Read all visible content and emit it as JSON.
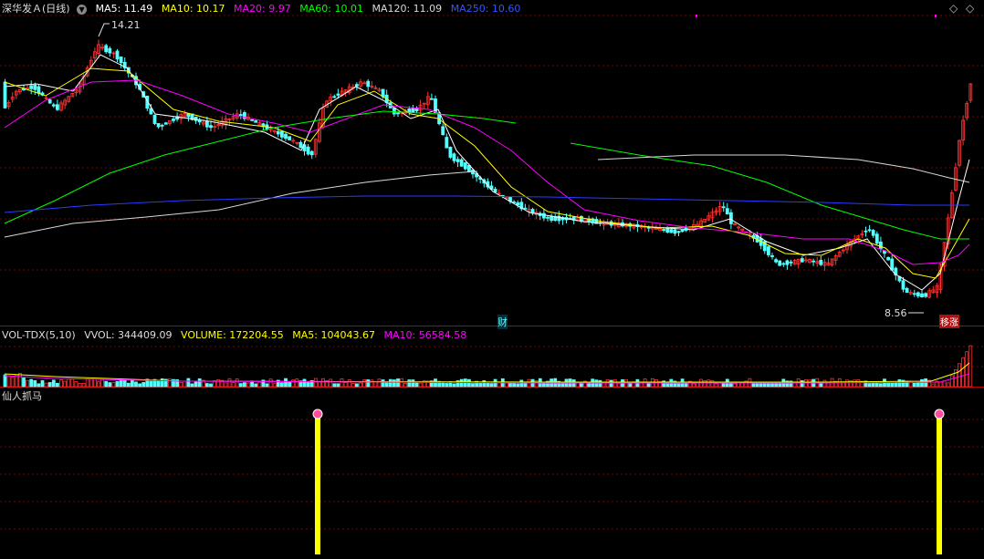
{
  "main": {
    "title": "深华发Ａ(日线)",
    "ma": [
      {
        "label": "MA5: 11.49",
        "color": "#ffffff"
      },
      {
        "label": "MA10: 10.17",
        "color": "#ffff00"
      },
      {
        "label": "MA20: 9.97",
        "color": "#ff00ff"
      },
      {
        "label": "MA60: 10.01",
        "color": "#00ff00"
      },
      {
        "label": "MA120: 11.09",
        "color": "#d8d8d8"
      },
      {
        "label": "MA250: 10.60",
        "color": "#0000ff"
      }
    ],
    "high_label": "14.21",
    "low_label": "8.56",
    "tag_cai": "财",
    "tag_zhang": "移涨"
  },
  "volume": {
    "title": "VOL-TDX(5,10)",
    "vvol": "VVOL: 344409.09",
    "volume": "VOLUME: 172204.55",
    "ma5": "MA5: 104043.67",
    "ma10": "MA10: 56584.58"
  },
  "indicator": {
    "title": "仙人抓马"
  },
  "colors": {
    "up": "#ff3232",
    "down": "#54ffff",
    "grid": "#7a0000",
    "separator": "#c00000",
    "signal": "#ffff00"
  },
  "chart_data": {
    "type": "candlestick",
    "price_range": [
      8.3,
      14.6
    ],
    "last_close": 13.0,
    "high": 14.21,
    "low": 8.56,
    "signals_at_candle_index": [
      82,
      250
    ]
  }
}
